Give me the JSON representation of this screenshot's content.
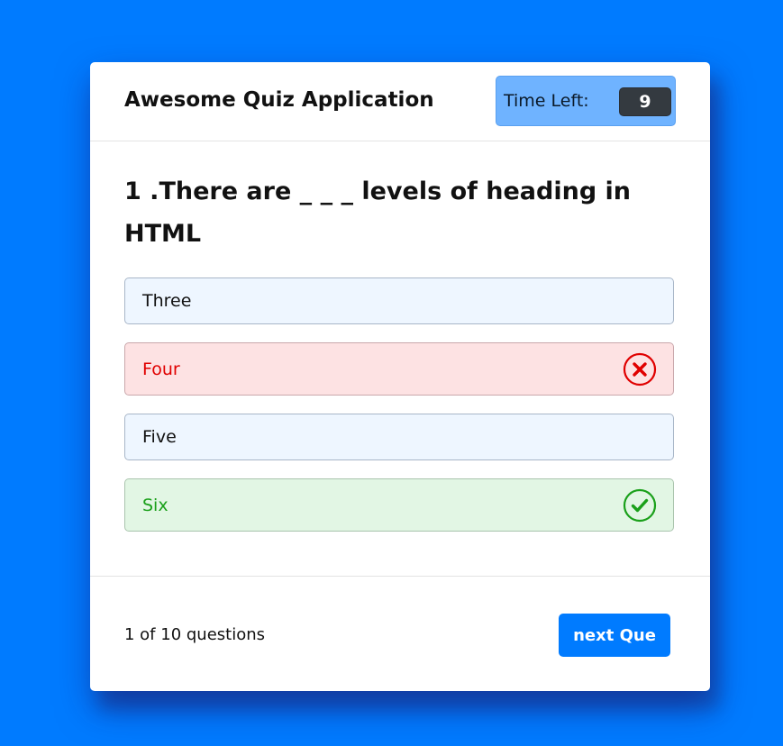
{
  "app": {
    "title": "Awesome Quiz Application"
  },
  "timer": {
    "label": "Time Left:",
    "seconds": "9"
  },
  "question": {
    "text": "1 .There are _ _ _ levels of heading in HTML"
  },
  "options": [
    {
      "label": "Three",
      "state": "default"
    },
    {
      "label": "Four",
      "state": "wrong",
      "icon": "cross-icon",
      "color": "#e00000"
    },
    {
      "label": "Five",
      "state": "default"
    },
    {
      "label": "Six",
      "state": "correct",
      "icon": "tick-icon",
      "color": "#1aa01a"
    }
  ],
  "footer": {
    "counter": "1 of 10 questions",
    "next_label": "next Que"
  },
  "colors": {
    "background": "#007bff",
    "accent": "#007bff",
    "timer_bg": "#6fb3ff"
  }
}
